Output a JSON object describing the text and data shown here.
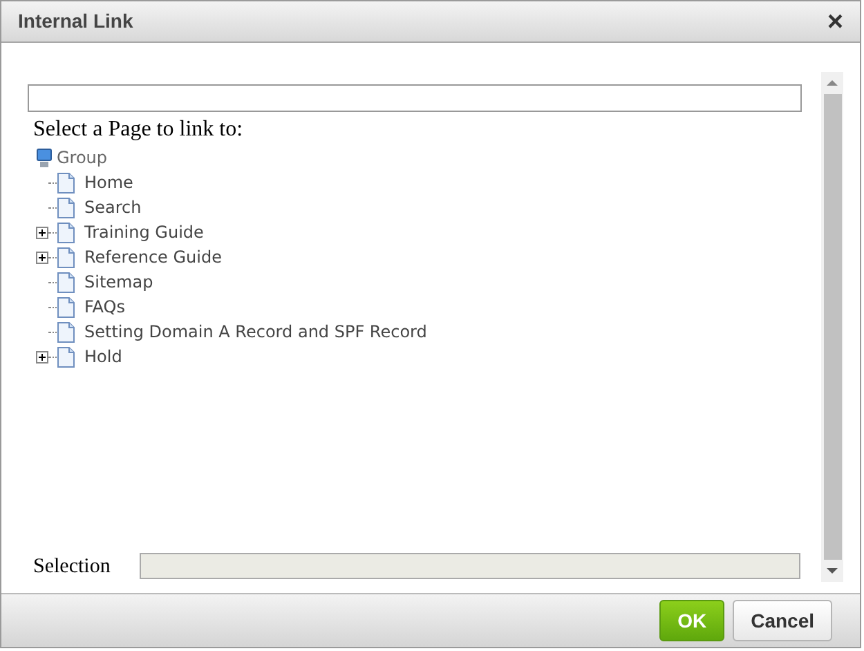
{
  "window": {
    "title": "Internal Link",
    "close": "×"
  },
  "prompt": "Select a Page to link to:",
  "tree": {
    "root": "Group",
    "children": [
      {
        "label": "Home",
        "kind": "leaf"
      },
      {
        "label": "Search",
        "kind": "leaf"
      },
      {
        "label": "Training Guide",
        "kind": "branch"
      },
      {
        "label": "Reference Guide",
        "kind": "branch"
      },
      {
        "label": "Sitemap",
        "kind": "leaf"
      },
      {
        "label": "FAQs",
        "kind": "leaf"
      },
      {
        "label": "Setting Domain A Record and SPF Record",
        "kind": "leaf"
      },
      {
        "label": "Hold",
        "kind": "branch"
      }
    ]
  },
  "selection_label": "Selection",
  "buttons": [
    {
      "label": "OK",
      "kind": "primary"
    },
    {
      "label": "Cancel",
      "kind": "secondary"
    }
  ]
}
